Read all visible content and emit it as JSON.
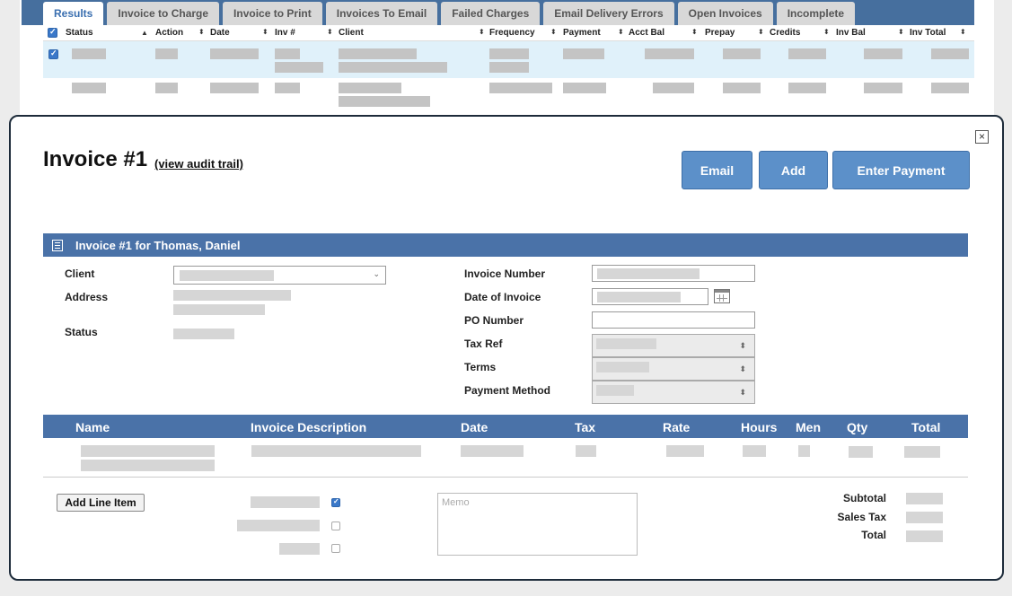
{
  "tabs": [
    "Results",
    "Invoice to Charge",
    "Invoice to Print",
    "Invoices To Email",
    "Failed Charges",
    "Email Delivery Errors",
    "Open Invoices",
    "Incomplete"
  ],
  "results": {
    "columns": [
      "Status",
      "Action",
      "Date",
      "Inv #",
      "Client",
      "Frequency",
      "Payment",
      "Acct Bal",
      "Prepay",
      "Credits",
      "Inv Bal",
      "Inv Total"
    ]
  },
  "modal": {
    "title": "Invoice #1",
    "audit_link": "(view audit trail)",
    "buttons": {
      "email": "Email",
      "add": "Add",
      "enter_payment": "Enter Payment"
    },
    "close_icon": "close-icon",
    "section_title": "Invoice #1 for Thomas, Daniel",
    "left_labels": {
      "client": "Client",
      "address": "Address",
      "status": "Status"
    },
    "right_labels": {
      "invoice_number": "Invoice Number",
      "date_of_invoice": "Date of Invoice",
      "po_number": "PO Number",
      "tax_ref": "Tax Ref",
      "terms": "Terms",
      "payment_method": "Payment Method"
    },
    "item_columns": [
      "Name",
      "Invoice Description",
      "Date",
      "Tax",
      "Rate",
      "Hours",
      "Men",
      "Qty",
      "Total"
    ],
    "add_line_item": "Add Line Item",
    "memo_placeholder": "Memo",
    "totals": {
      "subtotal": "Subtotal",
      "sales_tax": "Sales Tax",
      "total": "Total"
    }
  },
  "colors": {
    "header_blue": "#4a72a8",
    "button_blue": "#5c90c9",
    "row_highlight": "#e0f1fa"
  }
}
